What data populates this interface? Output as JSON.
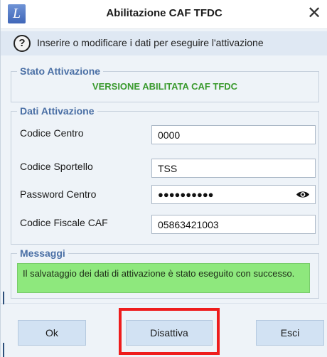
{
  "window": {
    "title": "Abilitazione CAF TFDC",
    "app_icon_letter": "L",
    "close_symbol": "✕"
  },
  "info": {
    "help_symbol": "?",
    "text": "Inserire o modificare i dati per eseguire l'attivazione"
  },
  "stato": {
    "legend": "Stato Attivazione",
    "status": "VERSIONE ABILITATA CAF TFDC",
    "status_color": "#3a9a2e"
  },
  "dati": {
    "legend": "Dati Attivazione",
    "fields": [
      {
        "label": "Codice Centro",
        "value": "0000"
      },
      {
        "label": "Codice Sportello",
        "value": "TSS"
      },
      {
        "label": "Password Centro",
        "masked": "●●●●●●●●●●"
      },
      {
        "label": "Codice Fiscale CAF",
        "value": "05863421003"
      }
    ]
  },
  "messaggi": {
    "legend": "Messaggi",
    "text": "Il salvataggio dei dati di attivazione è stato eseguito con successo.",
    "bg_color": "#8ee87d"
  },
  "buttons": {
    "ok": "Ok",
    "disattiva": "Disattiva",
    "esci": "Esci"
  },
  "colors": {
    "accent": "#4a6fa5",
    "highlight": "#ee1c1c",
    "button_bg": "#d2e2f3"
  },
  "icons": {
    "app": "app-logo-icon",
    "help": "help-icon",
    "close": "close-icon",
    "eye": "eye-icon"
  }
}
